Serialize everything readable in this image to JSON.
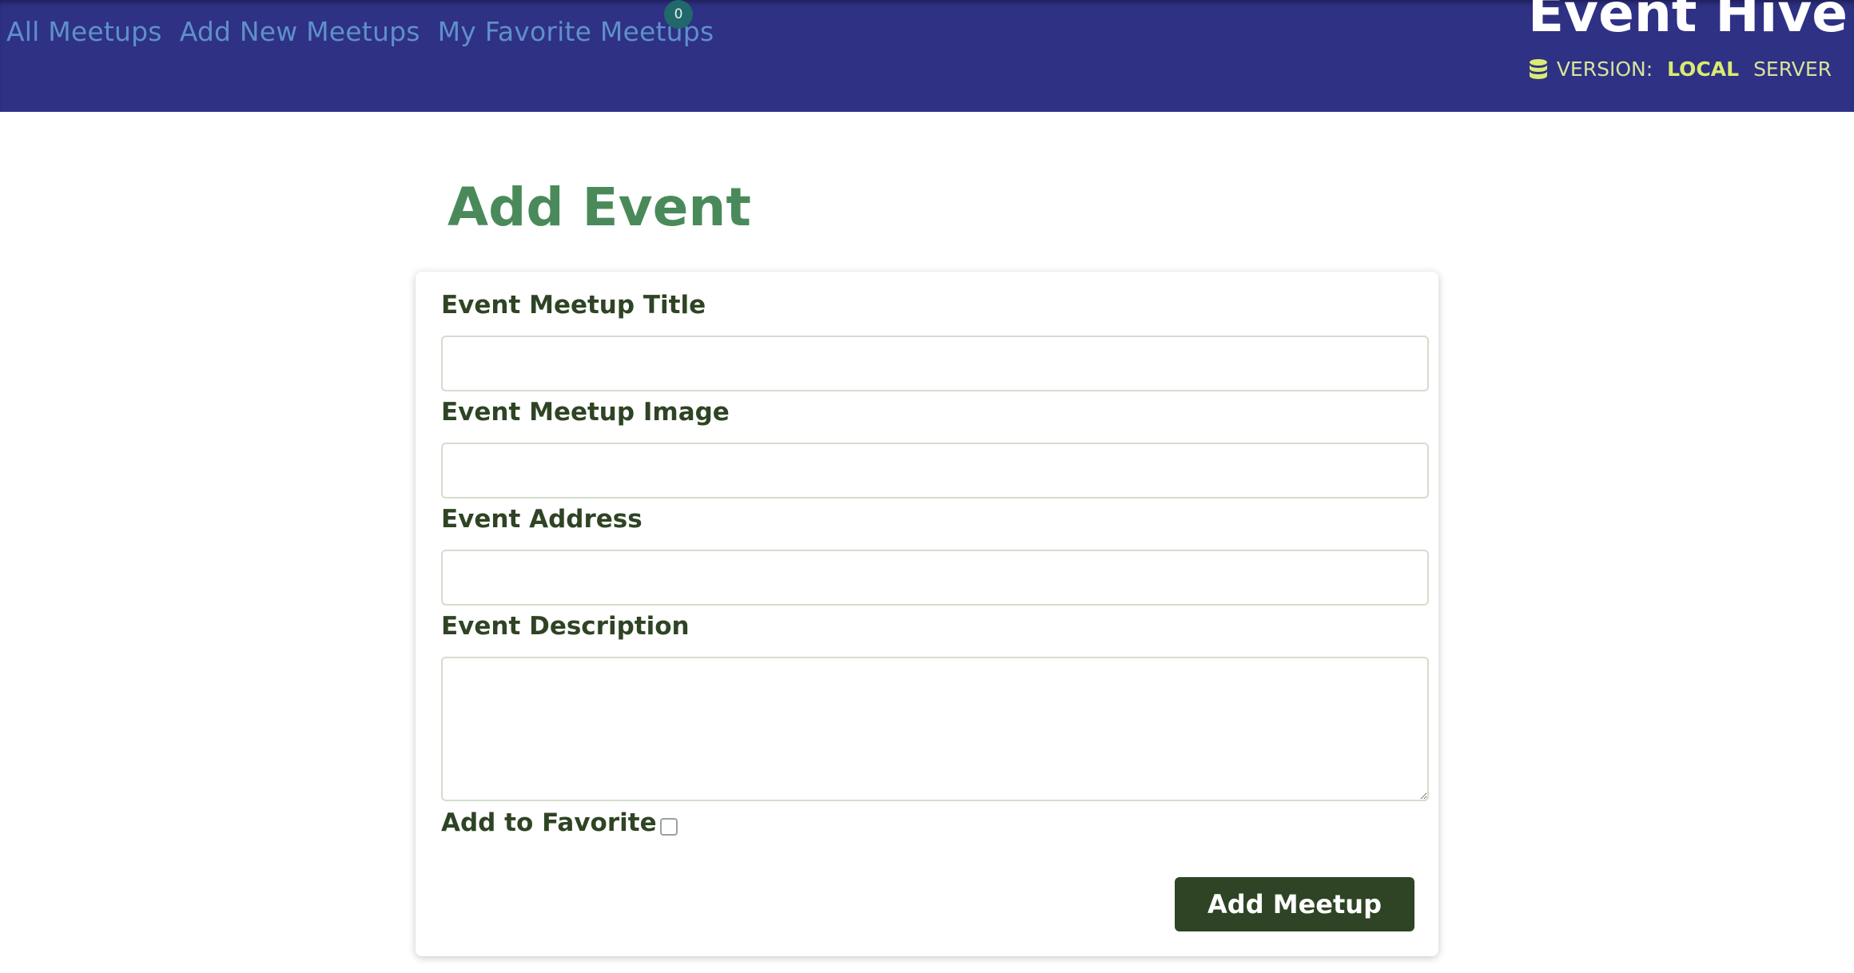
{
  "nav": {
    "items": [
      {
        "label": "All Meetups"
      },
      {
        "label": "Add New Meetups"
      },
      {
        "label": "My Favorite Meetups"
      }
    ],
    "favorites_count": "0"
  },
  "brand": {
    "title": "Event Hive"
  },
  "version": {
    "icon": "database-icon",
    "label": "VERSION:",
    "options": [
      "LOCAL",
      "SERVER"
    ],
    "selected": "LOCAL"
  },
  "form": {
    "heading": "Add Event",
    "title_label": "Event Meetup Title",
    "title_value": "",
    "image_label": "Event Meetup Image",
    "image_value": "",
    "address_label": "Event Address",
    "address_value": "",
    "description_label": "Event Description",
    "description_value": "",
    "favorite_label": "Add to Favorite",
    "favorite_checked": false,
    "submit_label": "Add Meetup"
  },
  "colors": {
    "header_bg": "#2f3185",
    "nav_link": "#5e90c9",
    "badge_bg": "#20686a",
    "version_text": "#d7e49a",
    "heading": "#4a8a5a",
    "label": "#2e4424",
    "button_bg": "#2e4424"
  }
}
